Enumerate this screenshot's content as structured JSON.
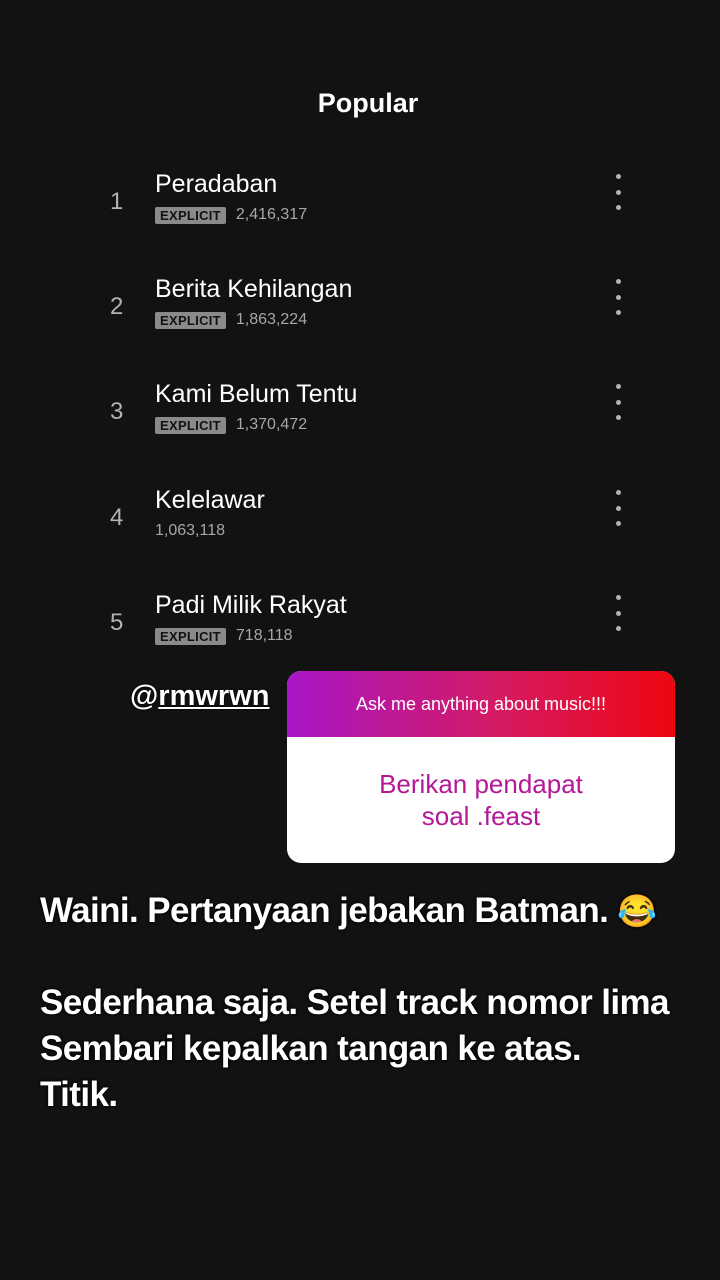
{
  "section_title": "Popular",
  "tracks": [
    {
      "num": "1",
      "title": "Peradaban",
      "explicit": "EXPLICIT",
      "plays": "2,416,317"
    },
    {
      "num": "2",
      "title": "Berita Kehilangan",
      "explicit": "EXPLICIT",
      "plays": "1,863,224"
    },
    {
      "num": "3",
      "title": "Kami Belum Tentu",
      "explicit": "EXPLICIT",
      "plays": "1,370,472"
    },
    {
      "num": "4",
      "title": "Kelelawar",
      "explicit": "",
      "plays": "1,063,118"
    },
    {
      "num": "5",
      "title": "Padi Milik Rakyat",
      "explicit": "EXPLICIT",
      "plays": "718,118"
    }
  ],
  "mention": {
    "at": "@",
    "handle": "rmwrwn"
  },
  "question": {
    "prompt": "Ask me anything about music!!!",
    "answer_line1": "Berikan pendapat",
    "answer_line2": "soal .feast"
  },
  "caption": {
    "line1": "Waini. Pertanyaan jebakan Batman.",
    "line1_emoji": "😂",
    "line2": "Sederhana saja. Setel track nomor lima",
    "line3": "Sembari kepalkan tangan ke atas.",
    "line4": "Titik."
  }
}
